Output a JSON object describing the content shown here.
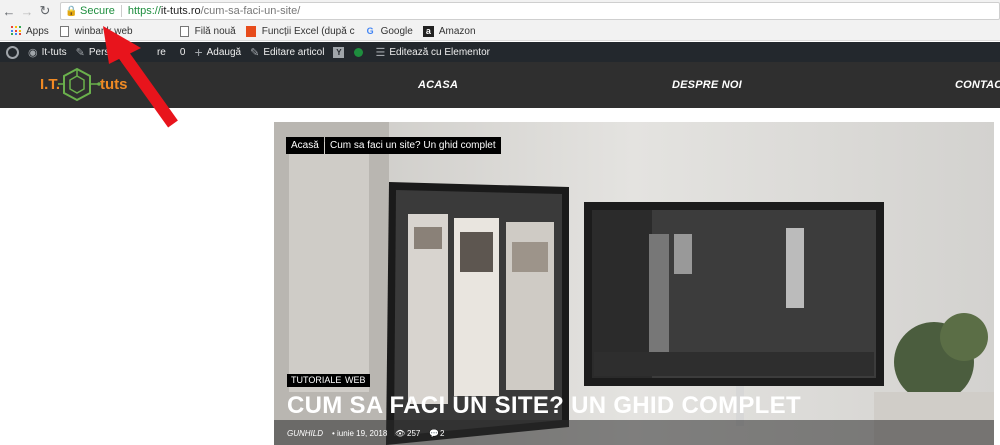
{
  "browser": {
    "secure_label": "Secure",
    "url_scheme": "https://",
    "url_host": "it-tuts.ro",
    "url_path": "/cum-sa-faci-un-site/"
  },
  "bookmarks": [
    {
      "label": "Apps",
      "icon": "apps-icon"
    },
    {
      "label": "winbank web",
      "icon": "page-icon"
    },
    {
      "label": "Filă nouă",
      "icon": "page-icon"
    },
    {
      "label": "Funcții Excel (după c",
      "icon": "office-icon"
    },
    {
      "label": "Google",
      "icon": "google-icon"
    },
    {
      "label": "Amazon",
      "icon": "amazon-icon"
    }
  ],
  "wp_admin": {
    "site": "It-tuts",
    "customize": "Perso",
    "customize_tail": "re",
    "count": "0",
    "add": "Adaugă",
    "edit": "Editare articol",
    "elementor": "Editează cu Elementor"
  },
  "site_header": {
    "logo_left": "I.T.",
    "logo_right": "tuts",
    "menu": [
      "ACASA",
      "DESPRE NOI",
      "CONTAC"
    ]
  },
  "hero": {
    "breadcrumbs": [
      "Acasă",
      "Cum sa faci un site? Un ghid complet"
    ],
    "categories": [
      "TUTORIALE",
      "WEB"
    ],
    "title": "CUM SA FACI UN SITE? UN GHID COMPLET",
    "author": "GUNHILD",
    "date": "• iunie 19, 2018",
    "views": "257",
    "comments": "2"
  },
  "colors": {
    "accent_orange": "#f08a24",
    "logo_green": "#6ab04c",
    "header_bg": "#2f2f2f",
    "wpbar_bg": "#23282d",
    "arrow_red": "#e8141c"
  }
}
